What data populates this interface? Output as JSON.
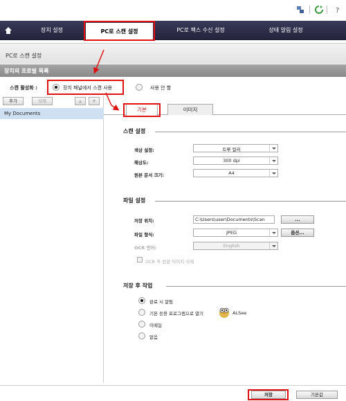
{
  "nav": {
    "tabs": [
      "장치 설정",
      "PC로 스캔 설정",
      "PC로 팩스 수신 설정",
      "상태 알림 설정"
    ]
  },
  "breadcrumb": "PC로 스캔 설정",
  "profile_list_title": "장치의 프로필 목록",
  "activation": {
    "label": "스캔 활성화 :",
    "option_on": "장치 패널에서 스캔 사용",
    "option_off": "사용 안 함",
    "selected": "option_on"
  },
  "left_toolbar": {
    "add": "추가",
    "delete": "삭제",
    "up": "▲",
    "down": "▼"
  },
  "profiles": [
    "My Documents"
  ],
  "tabs": [
    "기본",
    "이미지"
  ],
  "scan_settings": {
    "title": "스캔 설정",
    "color_label": "색상 설정:",
    "color_value": "트루 컬러",
    "resolution_label": "해상도:",
    "resolution_value": "300 dpi",
    "size_label": "원본 문서 크기:",
    "size_value": "A4"
  },
  "file_settings": {
    "title": "파일 설정",
    "location_label": "저장 위치:",
    "location_value": "C:\\Users\\user\\Documents\\Scan",
    "browse_label": "...",
    "format_label": "파일 형식:",
    "format_value": "JPEG",
    "options_label": "옵션...",
    "ocr_label": "OCR 언어:",
    "ocr_value": "English",
    "ocr_check_label": "OCR 후 원본 이미지 삭제"
  },
  "after_save": {
    "title": "저장 후 작업",
    "options": [
      "완료 시 알림",
      "기본 응용 프로그램으로 열기",
      "이메일",
      "없음"
    ],
    "selected": 0,
    "app_name": "ALSee"
  },
  "footer": {
    "save": "저장",
    "default": "기본값"
  },
  "colors": {
    "nav_bg": "#2a2a44",
    "highlight": "#e01010",
    "selected_row": "#cfe0f3"
  }
}
